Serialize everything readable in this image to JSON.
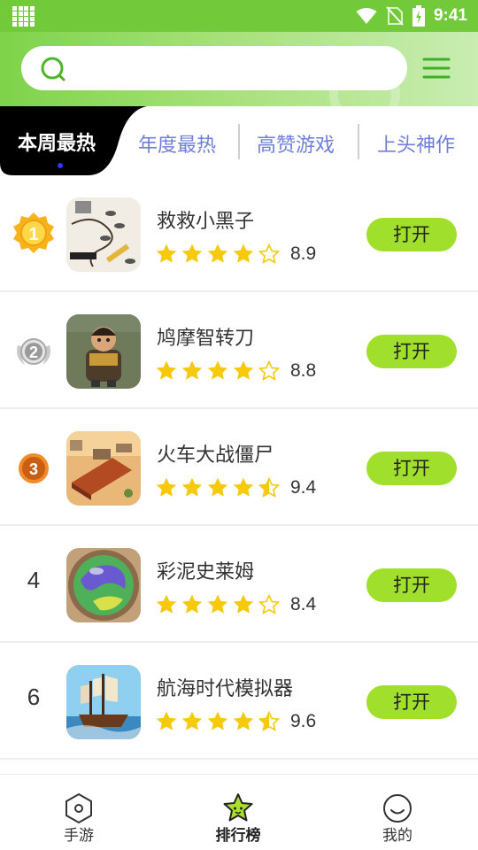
{
  "status_bar": {
    "time": "9:41"
  },
  "search": {
    "placeholder": ""
  },
  "tabs": [
    {
      "label": "本周最热",
      "active": true
    },
    {
      "label": "年度最热",
      "active": false
    },
    {
      "label": "高赞游戏",
      "active": false
    },
    {
      "label": "上头神作",
      "active": false
    }
  ],
  "games": [
    {
      "rank": "1",
      "rank_style": "gold-medal",
      "name": "救救小黑子",
      "score": "8.9",
      "stars": 4,
      "button": "打开"
    },
    {
      "rank": "2",
      "rank_style": "silver-medal",
      "name": "鸠摩智转刀",
      "score": "8.8",
      "stars": 4,
      "button": "打开"
    },
    {
      "rank": "3",
      "rank_style": "bronze-medal",
      "name": "火车大战僵尸",
      "score": "9.4",
      "stars": 4.5,
      "button": "打开"
    },
    {
      "rank": "4",
      "rank_style": "number",
      "name": "彩泥史莱姆",
      "score": "8.4",
      "stars": 4,
      "button": "打开"
    },
    {
      "rank": "6",
      "rank_style": "number",
      "name": "航海时代模拟器",
      "score": "9.6",
      "stars": 4.5,
      "button": "打开"
    }
  ],
  "bottom_nav": [
    {
      "label": "手游",
      "icon": "hexagon-icon",
      "active": false
    },
    {
      "label": "排行榜",
      "icon": "star-face-icon",
      "active": true
    },
    {
      "label": "我的",
      "icon": "smile-face-icon",
      "active": false
    }
  ],
  "colors": {
    "accent": "#a0df2c",
    "header": "#72c93a",
    "tab_text": "#6f7fd9",
    "star": "#f7c90b"
  }
}
